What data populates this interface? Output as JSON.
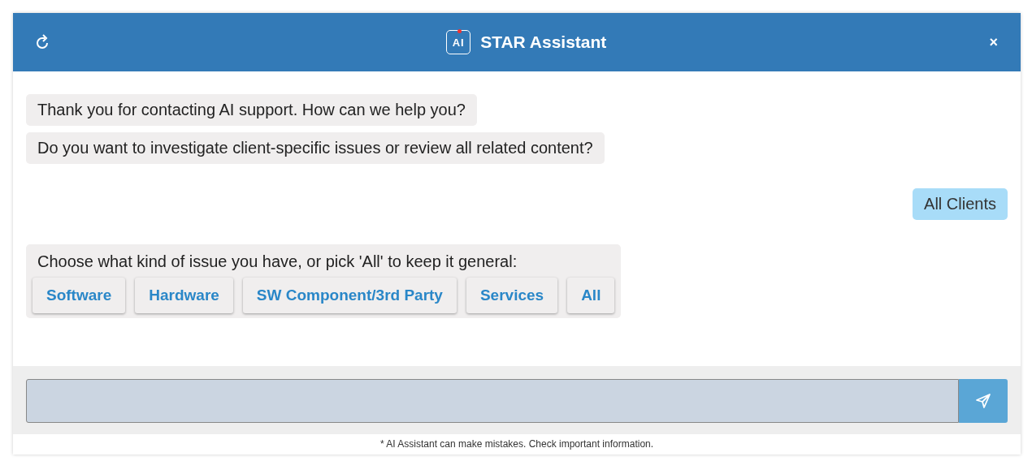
{
  "header": {
    "logo": "AI",
    "title": "STAR Assistant",
    "close": "×"
  },
  "messages": [
    {
      "kind": "bot",
      "text": "Thank you for contacting AI support. How can we help you?"
    },
    {
      "kind": "bot",
      "text": "Do you want to investigate client-specific issues or review all related content?"
    },
    {
      "kind": "user",
      "text": "All Clients"
    },
    {
      "kind": "bot",
      "text": "Choose what kind of issue you have, or pick 'All' to keep it general:",
      "options": [
        "Software",
        "Hardware",
        "SW Component/3rd Party",
        "Services",
        "All"
      ]
    }
  ],
  "disclaimer": "* AI Assistant can make mistakes. Check important information."
}
